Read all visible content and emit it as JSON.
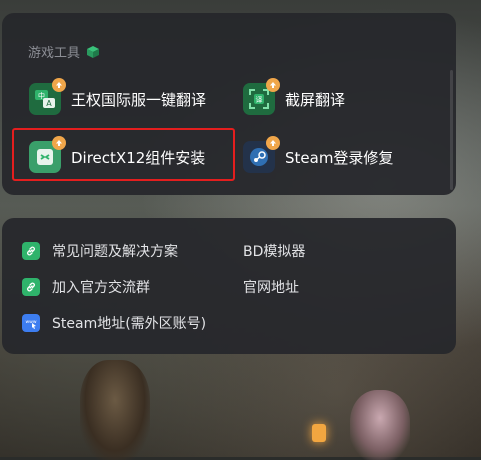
{
  "section": {
    "title": "游戏工具"
  },
  "tools": [
    {
      "label": "王权国际服一键翻译",
      "icon": "translate-a-icon"
    },
    {
      "label": "截屏翻译",
      "icon": "screenshot-translate-icon"
    },
    {
      "label": "DirectX12组件安装",
      "icon": "directx-install-icon"
    },
    {
      "label": "Steam登录修复",
      "icon": "steam-icon"
    }
  ],
  "links": [
    {
      "label": "常见问题及解决方案",
      "icon": "link-icon"
    },
    {
      "label": "BD模拟器",
      "icon": ""
    },
    {
      "label": "加入官方交流群",
      "icon": "link-icon"
    },
    {
      "label": "官网地址",
      "icon": ""
    },
    {
      "label": "Steam地址(需外区账号)",
      "icon": "web-link-icon"
    }
  ],
  "colors": {
    "accent_green": "#2fb36b",
    "badge_orange": "#f0a64a",
    "highlight_red": "#e41e1e",
    "link_blue": "#3d7df0"
  }
}
